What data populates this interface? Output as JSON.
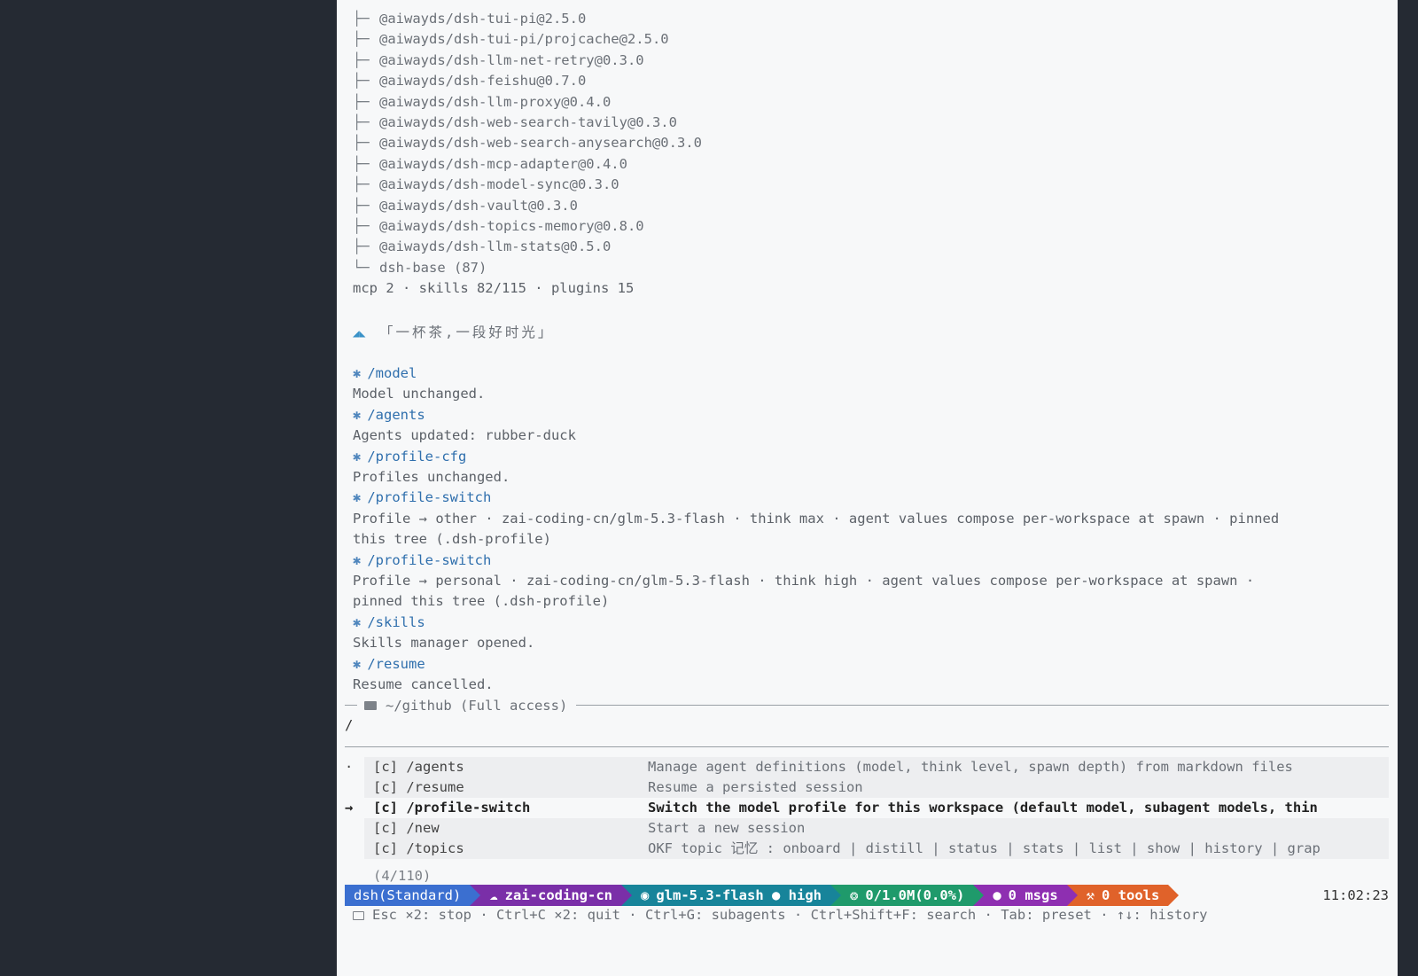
{
  "plugins": [
    "@aiwayds/dsh-tui-pi@2.5.0",
    "@aiwayds/dsh-tui-pi/projcache@2.5.0",
    "@aiwayds/dsh-llm-net-retry@0.3.0",
    "@aiwayds/dsh-feishu@0.7.0",
    "@aiwayds/dsh-llm-proxy@0.4.0",
    "@aiwayds/dsh-web-search-tavily@0.3.0",
    "@aiwayds/dsh-web-search-anysearch@0.3.0",
    "@aiwayds/dsh-mcp-adapter@0.4.0",
    "@aiwayds/dsh-model-sync@0.3.0",
    "@aiwayds/dsh-vault@0.3.0",
    "@aiwayds/dsh-topics-memory@0.8.0",
    "@aiwayds/dsh-llm-stats@0.5.0",
    "dsh-base (87)"
  ],
  "tree_glyph_branch": "├─",
  "tree_glyph_last": "└─",
  "summary": "mcp 2 · skills 82/115 · plugins 15",
  "greeting": "「一杯茶,一段好时光」",
  "history": [
    {
      "cmd": "/model",
      "out": [
        "Model unchanged."
      ]
    },
    {
      "cmd": "/agents",
      "out": [
        "Agents updated: rubber-duck"
      ]
    },
    {
      "cmd": "/profile-cfg",
      "out": [
        "Profiles unchanged."
      ]
    },
    {
      "cmd": "/profile-switch",
      "out": [
        "Profile → other · zai-coding-cn/glm-5.3-flash · think max · agent values compose per-workspace at spawn · pinned",
        "this tree (.dsh-profile)"
      ]
    },
    {
      "cmd": "/profile-switch",
      "out": [
        "Profile → personal · zai-coding-cn/glm-5.3-flash · think high · agent values compose per-workspace at spawn ·",
        "pinned this tree (.dsh-profile)"
      ]
    },
    {
      "cmd": "/skills",
      "out": [
        "Skills manager opened."
      ]
    },
    {
      "cmd": "/resume",
      "out": [
        "Resume cancelled."
      ]
    }
  ],
  "cmd_mark": "✱",
  "prompt": {
    "cwd_label": "~/github (Full access)",
    "input_value": "/"
  },
  "menu": {
    "items": [
      {
        "sel": "·",
        "cmd": "[c] /agents",
        "desc": "Manage agent definitions (model, think level, spawn depth) from markdown files",
        "active": false
      },
      {
        "sel": "",
        "cmd": "[c] /resume",
        "desc": "Resume a persisted session",
        "active": false
      },
      {
        "sel": "→",
        "cmd": "[c] /profile-switch",
        "desc": "Switch the model profile for this workspace (default model, subagent models, thin",
        "active": true
      },
      {
        "sel": "",
        "cmd": "[c] /new",
        "desc": "Start a new session",
        "active": false
      },
      {
        "sel": "",
        "cmd": "[c] /topics",
        "desc": "OKF topic 记忆 : onboard | distill | status | stats | list | show | history | grap",
        "active": false
      }
    ],
    "count": "(4/110)"
  },
  "status": {
    "profile": "dsh(Standard)",
    "provider": "zai-coding-cn",
    "model": "glm-5.3-flash ● high",
    "context": "0/1.0M(0.0%)",
    "msgs": "0 msgs",
    "tools": "0 tools",
    "clock": "11:02:23"
  },
  "hints": "Esc ×2: stop · Ctrl+C ×2: quit · Ctrl+G: subagents · Ctrl+Shift+F: search · Tab: preset · ↑↓: history"
}
